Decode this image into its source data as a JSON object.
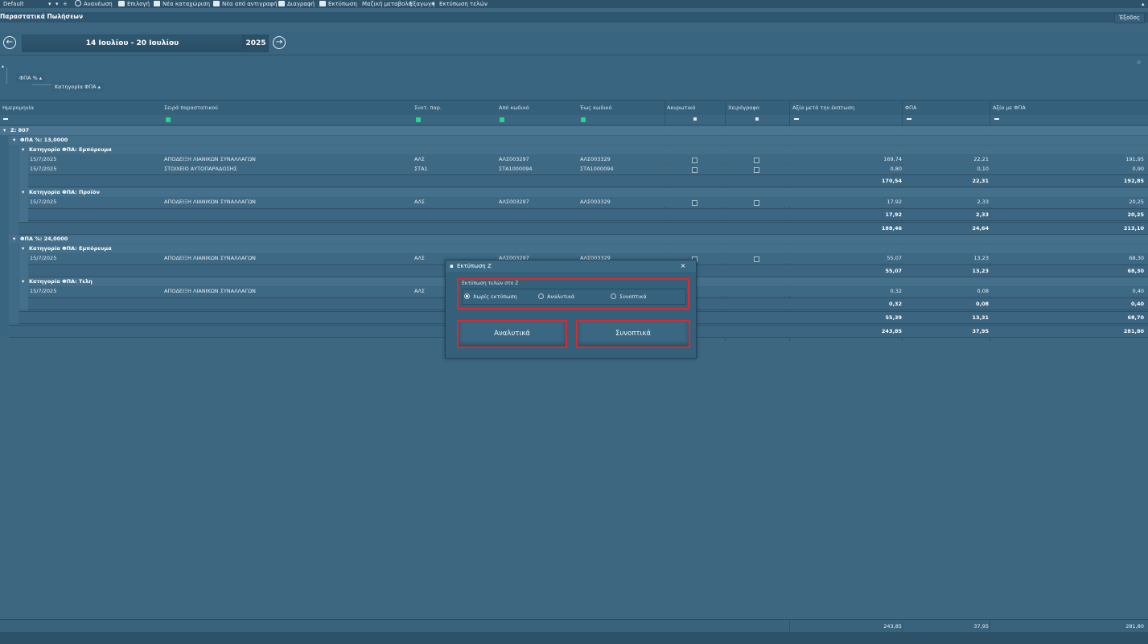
{
  "toolbar": {
    "layout_select": "Default",
    "refresh": "Ανανέωση",
    "select": "Επιλογή",
    "new_entry": "Νέα καταχώριση",
    "new_from_copy": "Νέα από αντιγραφή",
    "delete": "Διαγραφή",
    "print": "Εκτύπωση",
    "bulk_change": "Μαζική μεταβολή",
    "export": "Εξαγωγή",
    "print_fees": "Εκτύπωση τελών"
  },
  "titlebar": {
    "title": "Παραστατικά Πωλήσεων",
    "exit": "Έξοδος"
  },
  "week_nav": {
    "range": "14 Ιουλίου - 20 Ιουλίου",
    "year": "2025"
  },
  "grouping": {
    "level1": "ΦΠΑ %",
    "level2": "Κατηγορία ΦΠΑ"
  },
  "columns": [
    "Ημερομηνία",
    "Σειρά παραστατικού",
    "Συντ. παρ.",
    "Από κωδικό",
    "Έως κωδικό",
    "Ακυρωτικό",
    "Χειρόγραφο",
    "Αξία μετά την έκπτωση",
    "ΦΠΑ",
    "Αξία με ΦΠΑ"
  ],
  "groups": {
    "z": "Z: 807",
    "vat13": "ΦΠΑ %: 13,0000",
    "vat13_cat1": "Κατηγορία ΦΠΑ: Εμπόρευμα",
    "vat13_cat2": "Κατηγορία ΦΠΑ: Προϊόν",
    "vat24": "ΦΠΑ %: 24,0000",
    "vat24_cat1": "Κατηγορία ΦΠΑ: Εμπόρευμα",
    "vat24_cat2": "Κατηγορία ΦΠΑ: Τελη"
  },
  "rows": [
    {
      "date": "15/7/2025",
      "series": "ΑΠΟΔΕΙΞΗ ΛΙΑΝΙΚΩΝ ΣΥΝΑΛΛΑΓΩΝ",
      "abbr": "ΑΛΣ",
      "from": "ΑΛΣ003297",
      "to": "ΑΛΣ003329",
      "net": "169,74",
      "vat": "22,21",
      "gross": "191,95"
    },
    {
      "date": "15/7/2025",
      "series": "ΣΤΟΙΧΕΙΟ ΑΥΤΟΠΑΡΑΔΟΣΗΣ",
      "abbr": "ΣΤΑ1",
      "from": "ΣΤΑ1000094",
      "to": "ΣΤΑ1000094",
      "net": "0,80",
      "vat": "0,10",
      "gross": "0,90"
    },
    {
      "date": "15/7/2025",
      "series": "ΑΠΟΔΕΙΞΗ ΛΙΑΝΙΚΩΝ ΣΥΝΑΛΛΑΓΩΝ",
      "abbr": "ΑΛΣ",
      "from": "ΑΛΣ003297",
      "to": "ΑΛΣ003329",
      "net": "17,92",
      "vat": "2,33",
      "gross": "20,25"
    },
    {
      "date": "15/7/2025",
      "series": "ΑΠΟΔΕΙΞΗ ΛΙΑΝΙΚΩΝ ΣΥΝΑΛΛΑΓΩΝ",
      "abbr": "ΑΛΣ",
      "from": "ΑΛΣ003297",
      "to": "ΑΛΣ003329",
      "net": "55,07",
      "vat": "13,23",
      "gross": "68,30"
    },
    {
      "date": "15/7/2025",
      "series": "ΑΠΟΔΕΙΞΗ ΛΙΑΝΙΚΩΝ ΣΥΝΑΛΛΑΓΩΝ",
      "abbr": "ΑΛΣ",
      "from": "",
      "to": "",
      "net": "0,32",
      "vat": "0,08",
      "gross": "0,40"
    }
  ],
  "sums": {
    "s1": {
      "net": "170,54",
      "vat": "22,31",
      "gross": "192,85"
    },
    "s2": {
      "net": "17,92",
      "vat": "2,33",
      "gross": "20,25"
    },
    "s3": {
      "net": "188,46",
      "vat": "24,64",
      "gross": "213,10"
    },
    "s4": {
      "net": "55,07",
      "vat": "13,23",
      "gross": "68,30"
    },
    "s5": {
      "net": "0,32",
      "vat": "0,08",
      "gross": "0,40"
    },
    "s6": {
      "net": "55,39",
      "vat": "13,31",
      "gross": "68,70"
    },
    "s7": {
      "net": "243,85",
      "vat": "37,95",
      "gross": "281,80"
    }
  },
  "footer": {
    "net": "243,85",
    "vat": "37,95",
    "gross": "281,80"
  },
  "dialog": {
    "title": "Εκτύπωση Z",
    "group_label": "Εκτύπωση τελών στο Z",
    "opt_none": "Χωρίς εκτύπωση",
    "opt_detailed": "Αναλυτικά",
    "opt_summary": "Συνοπτικά",
    "btn_detailed": "Αναλυτικά",
    "btn_summary": "Συνοπτικά",
    "close": "×"
  },
  "colors": {
    "background": "#3d6680",
    "highlight": "#e0262f",
    "accent_green": "#29d58c"
  }
}
